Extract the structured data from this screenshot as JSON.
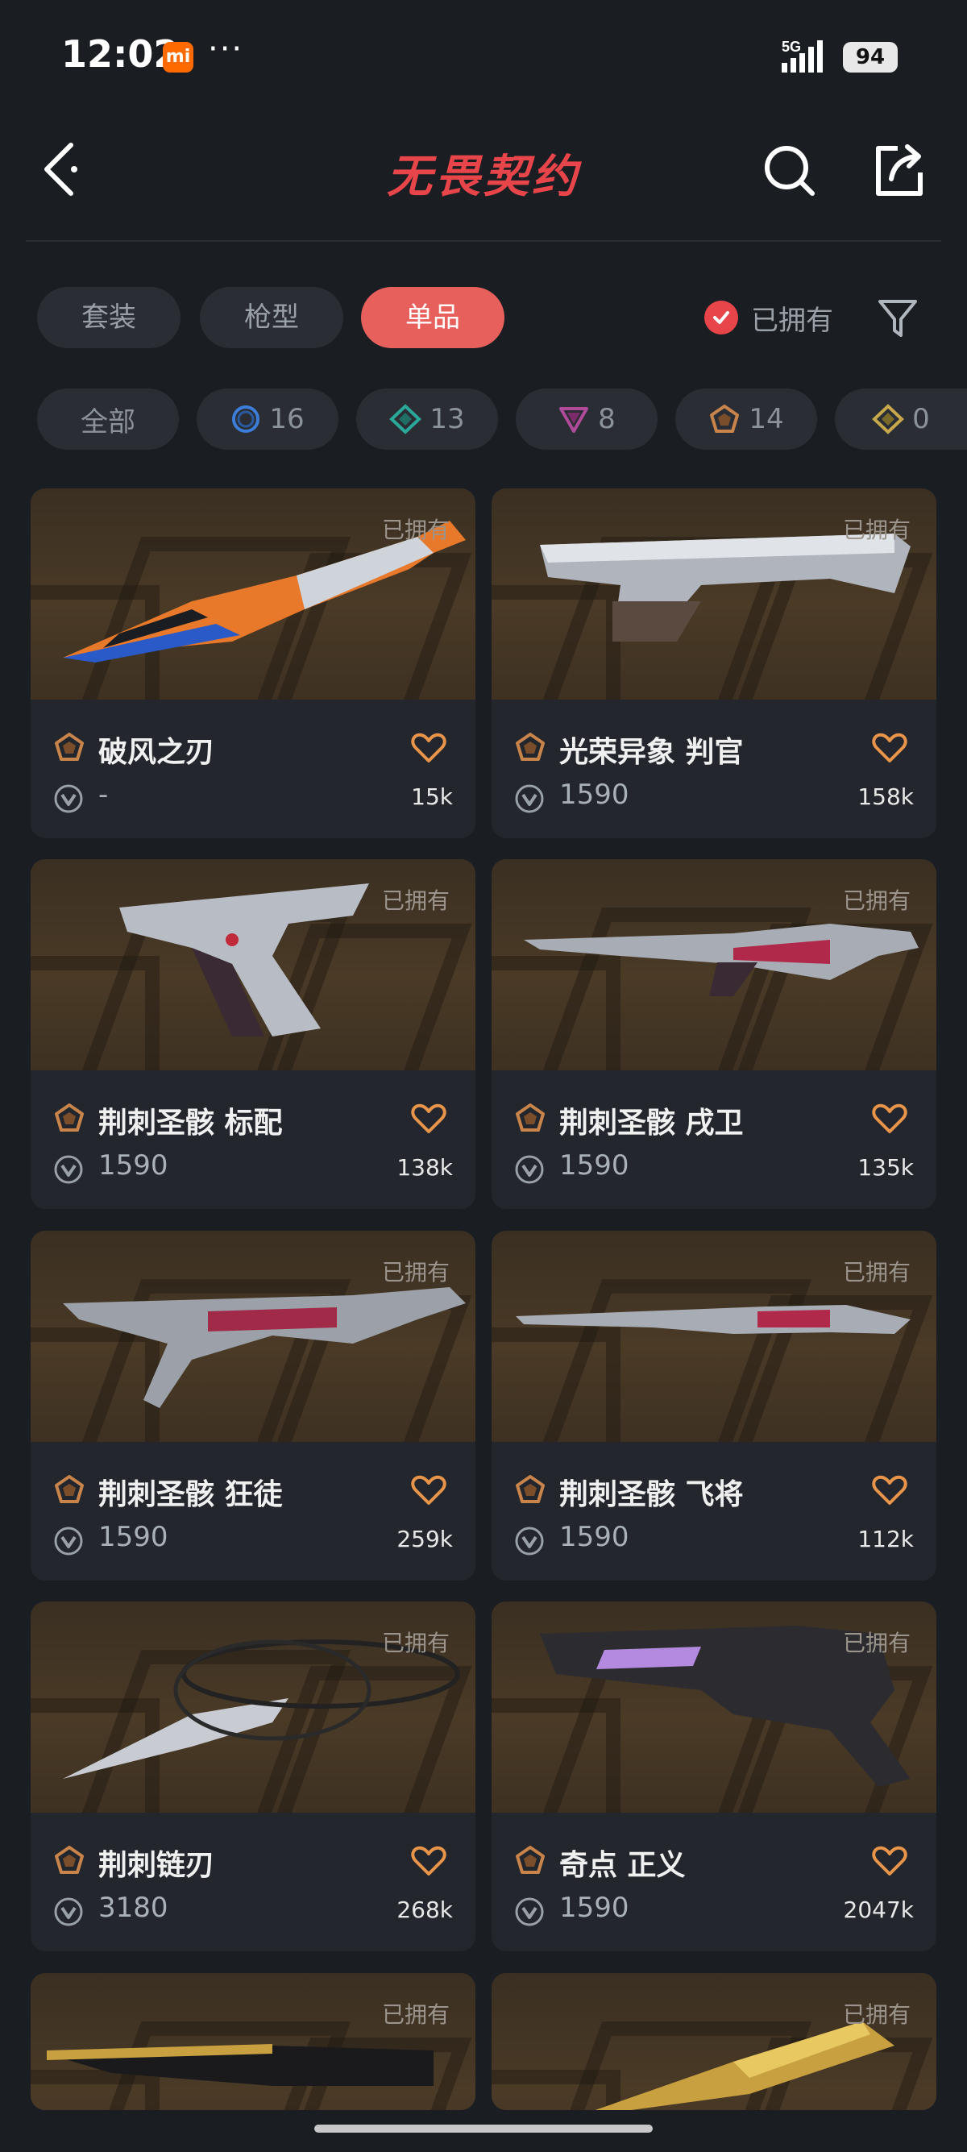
{
  "status": {
    "time": "12:02",
    "mi": "mi",
    "dots": "···",
    "network": "5G",
    "battery": "94"
  },
  "header": {
    "title": "无畏契约"
  },
  "tabs": [
    {
      "label": "套装",
      "active": false
    },
    {
      "label": "枪型",
      "active": false
    },
    {
      "label": "单品",
      "active": true
    }
  ],
  "owned_filter": {
    "label": "已拥有",
    "checked": true
  },
  "chips": [
    {
      "label": "全部",
      "icon": ""
    },
    {
      "label": "16",
      "icon": "select-tier-icon",
      "color": "#3b7dd8"
    },
    {
      "label": "13",
      "icon": "deluxe-tier-icon",
      "color": "#2aa89a"
    },
    {
      "label": "8",
      "icon": "premium-tier-icon",
      "color": "#b04a9a"
    },
    {
      "label": "14",
      "icon": "exclusive-tier-icon",
      "color": "#c8844a"
    },
    {
      "label": "0",
      "icon": "ultra-tier-icon",
      "color": "#c8a84a"
    }
  ],
  "owned_tag": "已拥有",
  "cards": [
    {
      "name": "破风之刃",
      "price": "-",
      "likes": "15k",
      "weapon": "knife-orange"
    },
    {
      "name": "光荣异象 判官",
      "price": "1590",
      "likes": "158k",
      "weapon": "shotgun"
    },
    {
      "name": "荆刺圣骸 标配",
      "price": "1590",
      "likes": "138k",
      "weapon": "pistol"
    },
    {
      "name": "荆刺圣骸 戌卫",
      "price": "1590",
      "likes": "135k",
      "weapon": "rifle"
    },
    {
      "name": "荆刺圣骸 狂徒",
      "price": "1590",
      "likes": "259k",
      "weapon": "rifle2"
    },
    {
      "name": "荆刺圣骸 飞将",
      "price": "1590",
      "likes": "112k",
      "weapon": "sniper"
    },
    {
      "name": "荆刺链刃",
      "price": "3180",
      "likes": "268k",
      "weapon": "knife-chain"
    },
    {
      "name": "奇点 正义",
      "price": "1590",
      "likes": "2047k",
      "weapon": "revolver"
    },
    {
      "name": "",
      "price": "",
      "likes": "",
      "weapon": "gold-rifle"
    },
    {
      "name": "",
      "price": "",
      "likes": "",
      "weapon": "gold-knife"
    }
  ],
  "colors": {
    "accent": "#e8605c",
    "title": "#e8454a",
    "exclusive": "#c8844a"
  }
}
